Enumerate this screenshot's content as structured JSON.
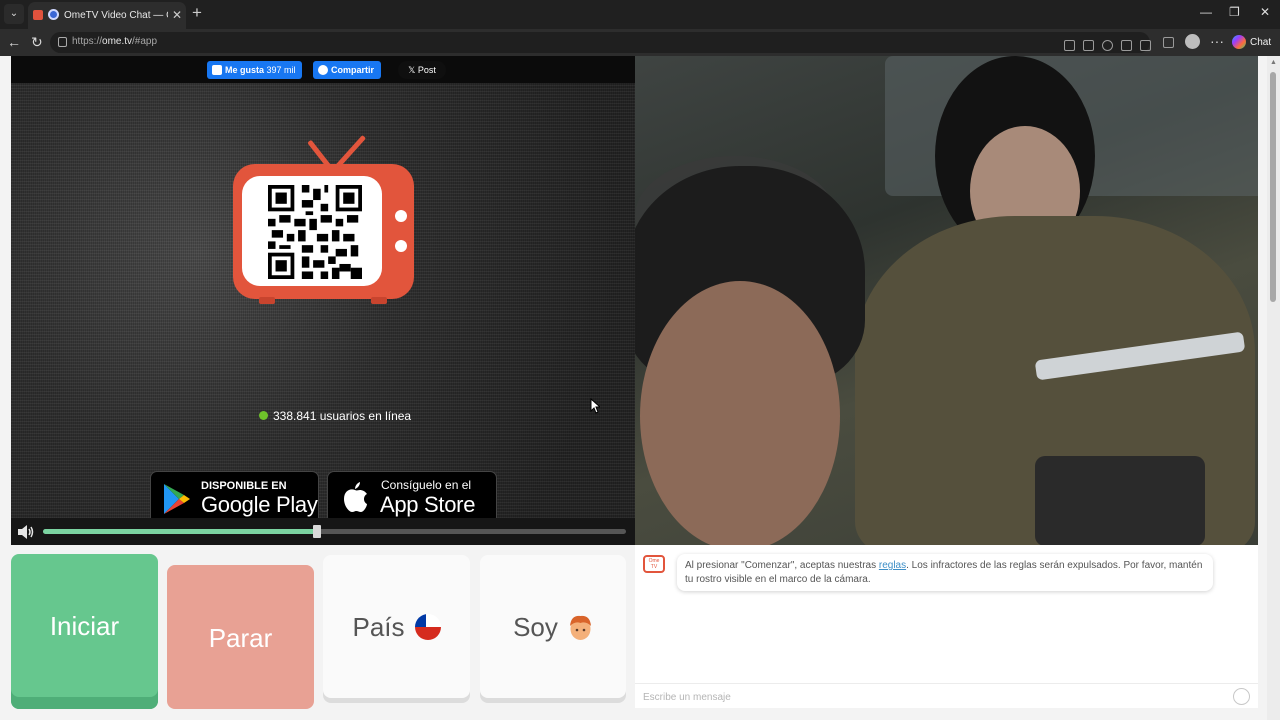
{
  "browser": {
    "tab_title": "OmeTV Video Chat — Omegle",
    "url_prefix": "https://",
    "url_host": "ome.tv",
    "url_path": "/#app",
    "copilot_label": "Chat"
  },
  "social": {
    "like_label": "Me gusta",
    "like_count": "397 mil",
    "share_label": "Compartir",
    "post_label": "Post"
  },
  "status": {
    "online_text": "338.841 usuarios en línea"
  },
  "stores": {
    "google_small": "DISPONIBLE EN",
    "google_big": "Google Play",
    "apple_small": "Consíguelo en el",
    "apple_big": "App Store"
  },
  "volume": {
    "level": 0.47
  },
  "controls": {
    "start_label": "Iniciar",
    "stop_label": "Parar",
    "country_label": "País",
    "gender_label": "Soy"
  },
  "chat": {
    "logo_text": "Ome TV",
    "notice_before": "Al presionar \"Comenzar\", aceptas nuestras ",
    "notice_link": "reglas",
    "notice_after": ". Los infractores de las reglas serán expulsados. Por favor, mantén tu rostro visible en el marco de la cámara.",
    "input_placeholder": "Escribe un mensaje"
  },
  "colors": {
    "brand_red": "#e2553c",
    "start_green": "#66c78e",
    "stop_red": "#e8a194",
    "facebook_blue": "#1877f2",
    "online_green": "#6ec12a"
  }
}
